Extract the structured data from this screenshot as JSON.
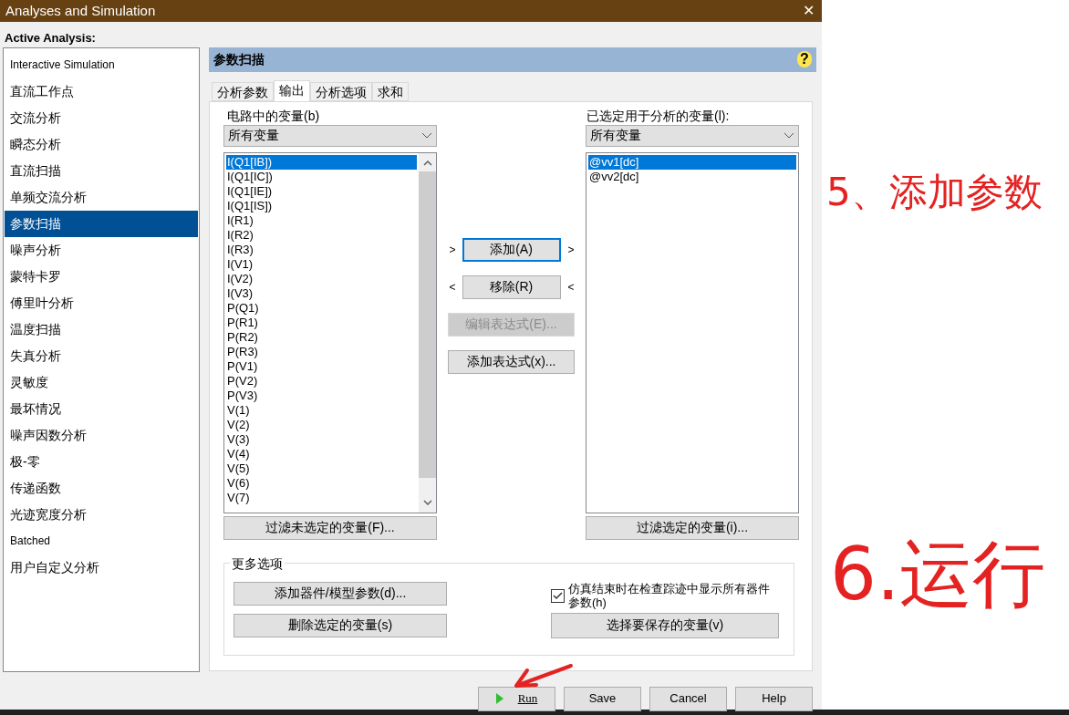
{
  "window": {
    "title": "Analyses and Simulation",
    "close": "✕"
  },
  "active_analysis_label": "Active Analysis:",
  "sidebar": {
    "items": [
      {
        "label": "Interactive Simulation",
        "kind": "small",
        "selected": false
      },
      {
        "label": "直流工作点",
        "kind": "normal",
        "selected": false
      },
      {
        "label": "交流分析",
        "kind": "normal",
        "selected": false
      },
      {
        "label": "瞬态分析",
        "kind": "normal",
        "selected": false
      },
      {
        "label": "直流扫描",
        "kind": "normal",
        "selected": false
      },
      {
        "label": "单频交流分析",
        "kind": "normal",
        "selected": false
      },
      {
        "label": "参数扫描",
        "kind": "normal",
        "selected": true
      },
      {
        "label": "噪声分析",
        "kind": "normal",
        "selected": false
      },
      {
        "label": "蒙特卡罗",
        "kind": "normal",
        "selected": false
      },
      {
        "label": "傅里叶分析",
        "kind": "normal",
        "selected": false
      },
      {
        "label": "温度扫描",
        "kind": "normal",
        "selected": false
      },
      {
        "label": "失真分析",
        "kind": "normal",
        "selected": false
      },
      {
        "label": "灵敏度",
        "kind": "normal",
        "selected": false
      },
      {
        "label": "最坏情况",
        "kind": "normal",
        "selected": false
      },
      {
        "label": "噪声因数分析",
        "kind": "normal",
        "selected": false
      },
      {
        "label": "极-零",
        "kind": "normal",
        "selected": false
      },
      {
        "label": "传递函数",
        "kind": "normal",
        "selected": false
      },
      {
        "label": "光迹宽度分析",
        "kind": "normal",
        "selected": false
      },
      {
        "label": "Batched",
        "kind": "small",
        "selected": false
      },
      {
        "label": "用户自定义分析",
        "kind": "normal",
        "selected": false
      }
    ]
  },
  "panel": {
    "title": "参数扫描",
    "help": "?",
    "tabs": [
      {
        "label": "分析参数",
        "selected": false
      },
      {
        "label": "输出",
        "selected": true
      },
      {
        "label": "分析选项",
        "selected": false
      },
      {
        "label": "求和",
        "selected": false
      }
    ],
    "circuit_variables": {
      "label": "电路中的变量(b)",
      "filter": "所有变量",
      "button": "过滤未选定的变量(F)...",
      "items": [
        {
          "label": "I(Q1[IB])",
          "selected": true
        },
        {
          "label": "I(Q1[IC])",
          "selected": false
        },
        {
          "label": "I(Q1[IE])",
          "selected": false
        },
        {
          "label": "I(Q1[IS])",
          "selected": false
        },
        {
          "label": "I(R1)",
          "selected": false
        },
        {
          "label": "I(R2)",
          "selected": false
        },
        {
          "label": "I(R3)",
          "selected": false
        },
        {
          "label": "I(V1)",
          "selected": false
        },
        {
          "label": "I(V2)",
          "selected": false
        },
        {
          "label": "I(V3)",
          "selected": false
        },
        {
          "label": "P(Q1)",
          "selected": false
        },
        {
          "label": "P(R1)",
          "selected": false
        },
        {
          "label": "P(R2)",
          "selected": false
        },
        {
          "label": "P(R3)",
          "selected": false
        },
        {
          "label": "P(V1)",
          "selected": false
        },
        {
          "label": "P(V2)",
          "selected": false
        },
        {
          "label": "P(V3)",
          "selected": false
        },
        {
          "label": "V(1)",
          "selected": false
        },
        {
          "label": "V(2)",
          "selected": false
        },
        {
          "label": "V(3)",
          "selected": false
        },
        {
          "label": "V(4)",
          "selected": false
        },
        {
          "label": "V(5)",
          "selected": false
        },
        {
          "label": "V(6)",
          "selected": false
        },
        {
          "label": "V(7)",
          "selected": false
        }
      ]
    },
    "middle_buttons": [
      {
        "label": "添加(A)",
        "left": ">",
        "right": ">",
        "disabled": false,
        "focused": true
      },
      {
        "label": "移除(R)",
        "left": "<",
        "right": "<",
        "disabled": false,
        "focused": false
      },
      {
        "label": "编辑表达式(E)...",
        "disabled": true,
        "focused": false
      },
      {
        "label": "添加表达式(x)...",
        "disabled": false,
        "focused": false
      }
    ],
    "selected_variables": {
      "label": "已选定用于分析的变量(l):",
      "filter": "所有变量",
      "button": "过滤选定的变量(i)...",
      "items": [
        {
          "label": "@vv1[dc]",
          "selected": true
        },
        {
          "label": "@vv2[dc]",
          "selected": false
        }
      ]
    },
    "more_options": {
      "title": "更多选项",
      "buttons": [
        "添加器件/模型参数(d)...",
        "删除选定的变量(s)"
      ],
      "checkbox": {
        "label": "仿真结束时在检查踪迹中显示所有器件参数(h)",
        "checked": true
      },
      "save_button": "选择要保存的变量(v)"
    }
  },
  "footer_buttons": [
    {
      "label": "Run",
      "kind": "run"
    },
    {
      "label": "Save",
      "kind": "plain"
    },
    {
      "label": "Cancel",
      "kind": "plain"
    },
    {
      "label": "Help",
      "kind": "plain"
    }
  ],
  "annotations": [
    {
      "text": "5、添加参数",
      "kind": "step_top"
    },
    {
      "text": "6.运行",
      "kind": "step_bottom"
    }
  ]
}
